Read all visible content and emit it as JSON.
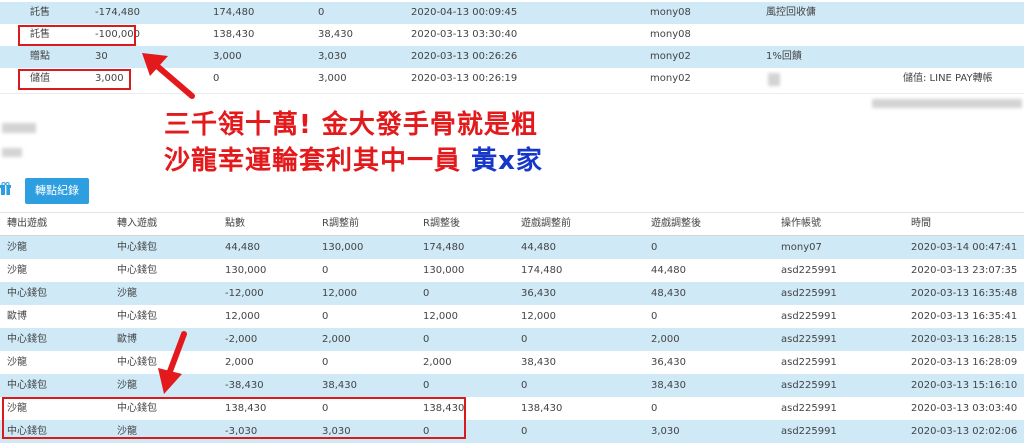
{
  "top_rows": [
    {
      "c1": "託售",
      "c2": "-174,480",
      "c3": "174,480",
      "c4": "0",
      "c5": "2020-04-13 00:09:45",
      "c6": "mony08",
      "c7": "風控回收傭",
      "c8": ""
    },
    {
      "c1": "託售",
      "c2": "-100,000",
      "c3": "138,430",
      "c4": "38,430",
      "c5": "2020-03-13 03:30:40",
      "c6": "mony08",
      "c7": "",
      "c8": ""
    },
    {
      "c1": "贈點",
      "c2": "30",
      "c3": "3,000",
      "c4": "3,030",
      "c5": "2020-03-13 00:26:26",
      "c6": "mony02",
      "c7": "1%回饋",
      "c8": ""
    },
    {
      "c1": "儲值",
      "c2": "3,000",
      "c3": "0",
      "c4": "3,000",
      "c5": "2020-03-13 00:26:19",
      "c6": "mony02",
      "c7": "",
      "c8": "儲值: LINE PAY轉帳"
    }
  ],
  "caption": {
    "line1": "三千領十萬! 金大發手骨就是粗",
    "line2_red": "沙龍幸運輪套利其中一員 ",
    "line2_blue": "黃x家"
  },
  "transfer_button": "轉點紀錄",
  "table": {
    "headers": [
      "轉出遊戲",
      "轉入遊戲",
      "點數",
      "R調整前",
      "R調整後",
      "遊戲調整前",
      "遊戲調整後",
      "操作帳號",
      "時間"
    ],
    "rows": [
      [
        "沙龍",
        "中心錢包",
        "44,480",
        "130,000",
        "174,480",
        "44,480",
        "0",
        "mony07",
        "2020-03-14 00:47:41"
      ],
      [
        "沙龍",
        "中心錢包",
        "130,000",
        "0",
        "130,000",
        "174,480",
        "44,480",
        "asd225991",
        "2020-03-13 23:07:35"
      ],
      [
        "中心錢包",
        "沙龍",
        "-12,000",
        "12,000",
        "0",
        "36,430",
        "48,430",
        "asd225991",
        "2020-03-13 16:35:48"
      ],
      [
        "歐博",
        "中心錢包",
        "12,000",
        "0",
        "12,000",
        "12,000",
        "0",
        "asd225991",
        "2020-03-13 16:35:41"
      ],
      [
        "中心錢包",
        "歐博",
        "-2,000",
        "2,000",
        "0",
        "0",
        "2,000",
        "asd225991",
        "2020-03-13 16:28:15"
      ],
      [
        "沙龍",
        "中心錢包",
        "2,000",
        "0",
        "2,000",
        "38,430",
        "36,430",
        "asd225991",
        "2020-03-13 16:28:09"
      ],
      [
        "中心錢包",
        "沙龍",
        "-38,430",
        "38,430",
        "0",
        "0",
        "38,430",
        "asd225991",
        "2020-03-13 15:16:10"
      ],
      [
        "沙龍",
        "中心錢包",
        "138,430",
        "0",
        "138,430",
        "138,430",
        "0",
        "asd225991",
        "2020-03-13 03:03:40"
      ],
      [
        "中心錢包",
        "沙龍",
        "-3,030",
        "3,030",
        "0",
        "0",
        "3,030",
        "asd225991",
        "2020-03-13 02:02:06"
      ]
    ]
  },
  "colors": {
    "row_blue": "#cfe9f6",
    "annotation_red": "#e3191c",
    "button_blue": "#2d9ee0",
    "name_blue": "#1538c9"
  },
  "icons": [
    "gift-icon",
    "red-arrow-annotation"
  ]
}
